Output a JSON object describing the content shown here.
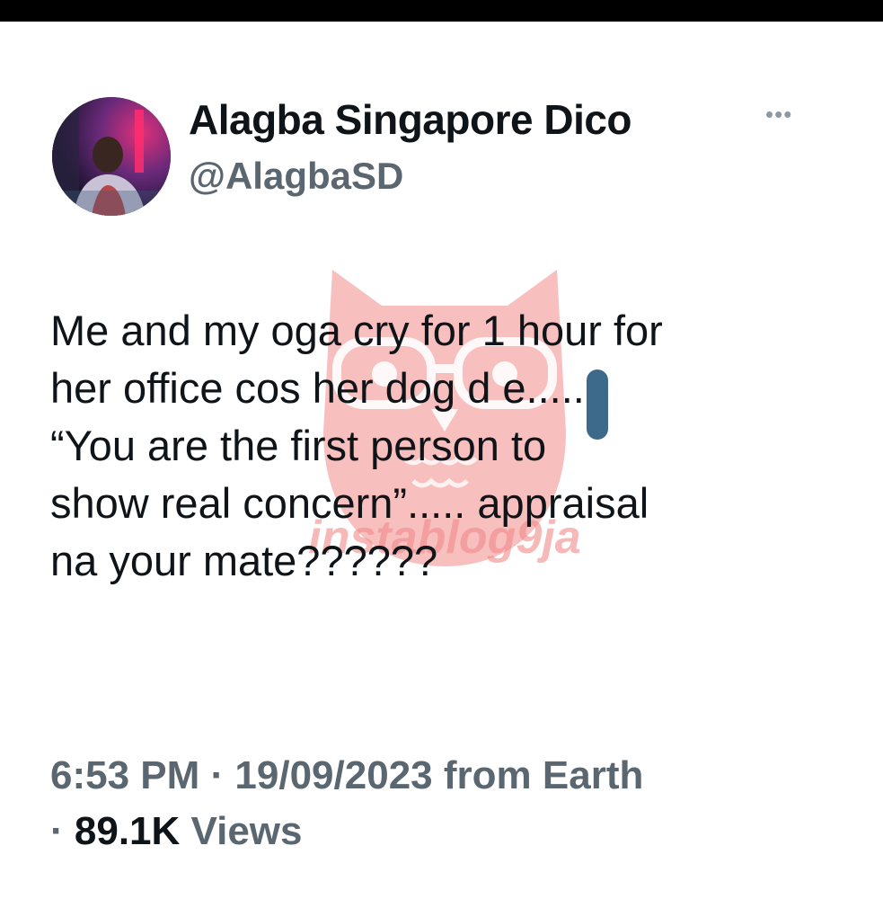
{
  "tweet": {
    "author": {
      "display_name": "Alagba Singapore Dico",
      "handle": "@AlagbaSD",
      "more_icon": "more-horizontal-icon"
    },
    "text": "Me and my oga cry for 1 hour for\nher office cos her dog d e.....\n“You are the first person to\nshow real concern”..... appraisal\nna your mate??????",
    "timestamp": "6:53 PM",
    "date": "19/09/2023",
    "source": "from Earth",
    "separator": "·",
    "views_count": "89.1K",
    "views_label": "Views"
  },
  "watermark": {
    "text": "instablog9ja",
    "color": "#f28a8a"
  },
  "colors": {
    "text_primary": "#0f1419",
    "text_secondary": "#5b6770",
    "redaction": "#3d6a8a",
    "top_bar": "#000000"
  }
}
